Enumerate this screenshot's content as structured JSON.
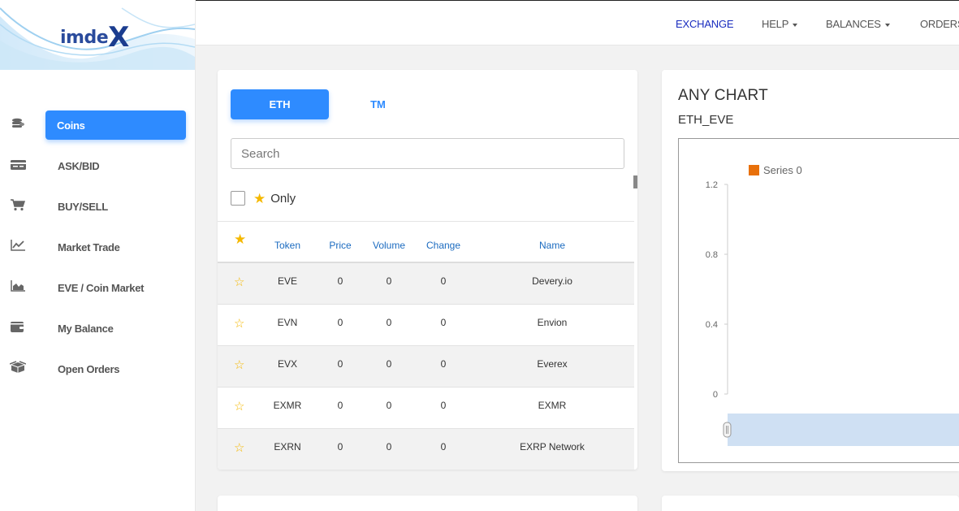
{
  "logo": {
    "text": "imde",
    "x": "X"
  },
  "sidebar": {
    "items": [
      {
        "label": "Coins",
        "icon": "coins-icon",
        "active": true
      },
      {
        "label": "ASK/BID",
        "icon": "card-icon",
        "active": false
      },
      {
        "label": "BUY/SELL",
        "icon": "cart-icon",
        "active": false
      },
      {
        "label": "Market Trade",
        "icon": "line-chart-icon",
        "active": false
      },
      {
        "label": "EVE / Coin Market",
        "icon": "area-chart-icon",
        "active": false
      },
      {
        "label": "My Balance",
        "icon": "wallet-icon",
        "active": false
      },
      {
        "label": "Open Orders",
        "icon": "box-icon",
        "active": false
      }
    ]
  },
  "topnav": {
    "exchange": "EXCHANGE",
    "help": "HELP",
    "balances": "BALANCES",
    "orders": "ORDERS"
  },
  "market": {
    "tabs": [
      "ETH",
      "TM"
    ],
    "search_placeholder": "Search",
    "only_label": "Only",
    "columns": {
      "token": "Token",
      "price": "Price",
      "volume": "Volume",
      "change": "Change",
      "name": "Name"
    },
    "rows": [
      {
        "token": "EVE",
        "price": "0",
        "volume": "0",
        "change": "0",
        "name": "Devery.io"
      },
      {
        "token": "EVN",
        "price": "0",
        "volume": "0",
        "change": "0",
        "name": "Envion"
      },
      {
        "token": "EVX",
        "price": "0",
        "volume": "0",
        "change": "0",
        "name": "Everex"
      },
      {
        "token": "EXMR",
        "price": "0",
        "volume": "0",
        "change": "0",
        "name": "EXMR"
      },
      {
        "token": "EXRN",
        "price": "0",
        "volume": "0",
        "change": "0",
        "name": "EXRP Network"
      }
    ]
  },
  "chart": {
    "title": "ANY CHART",
    "pair": "ETH_EVE",
    "colors": {
      "series": "#e8700b",
      "navigator": "#cfe0f3"
    }
  },
  "chart_data": {
    "type": "line",
    "title": "",
    "xlabel": "",
    "ylabel": "",
    "yticks": [
      "1.2",
      "0.8",
      "0.4",
      "0"
    ],
    "ylim": [
      0,
      1.2
    ],
    "legend": "top-left",
    "series": [
      {
        "name": "Series 0",
        "values": []
      }
    ]
  }
}
